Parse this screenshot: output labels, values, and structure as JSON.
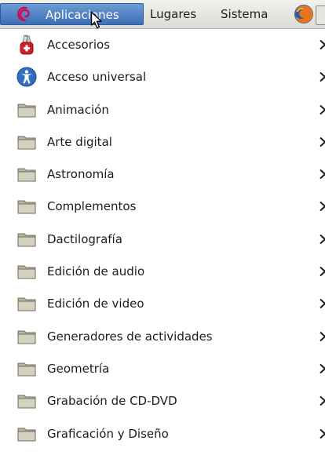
{
  "panel": {
    "applications_label": "Aplicaciones",
    "places_label": "Lugares",
    "system_label": "Sistema",
    "icons": [
      "debian-swirl-icon",
      "firefox-icon",
      "mouse-pointer-icon"
    ]
  },
  "menu": {
    "items": [
      {
        "label": "Accesorios",
        "icon": "swiss-knife-icon"
      },
      {
        "label": "Acceso universal",
        "icon": "accessibility-icon"
      },
      {
        "label": "Animación",
        "icon": "folder-icon"
      },
      {
        "label": "Arte digital",
        "icon": "folder-icon"
      },
      {
        "label": "Astronomía",
        "icon": "folder-icon"
      },
      {
        "label": "Complementos",
        "icon": "folder-icon"
      },
      {
        "label": "Dactilografía",
        "icon": "folder-icon"
      },
      {
        "label": "Edición de audio",
        "icon": "folder-icon"
      },
      {
        "label": "Edición de video",
        "icon": "folder-icon"
      },
      {
        "label": "Generadores de actividades",
        "icon": "folder-icon"
      },
      {
        "label": "Geometría",
        "icon": "folder-icon"
      },
      {
        "label": "Grabación de CD-DVD",
        "icon": "folder-icon"
      },
      {
        "label": "Graficación y Diseño",
        "icon": "folder-icon"
      }
    ]
  },
  "colors": {
    "selection": "#3c6fb5",
    "debian_red": "#d70751",
    "folder": "#c9c6b3",
    "accessibility_blue": "#2f6ec0"
  }
}
